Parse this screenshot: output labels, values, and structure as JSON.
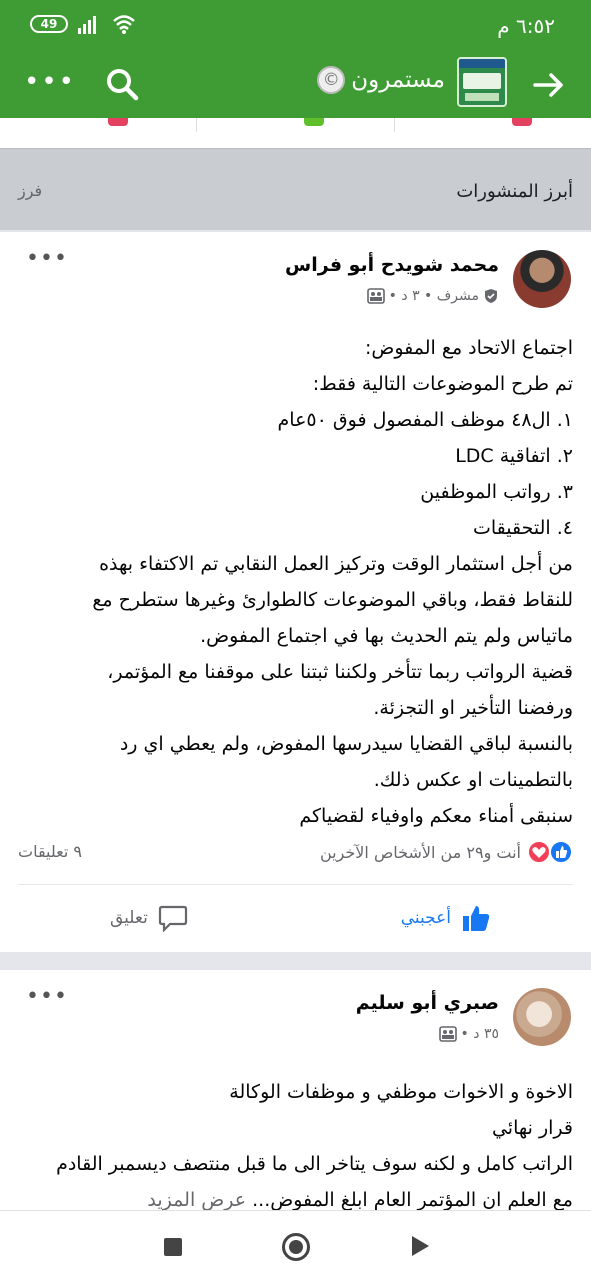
{
  "status_bar": {
    "time": "٦:٥٢ م",
    "battery": "49"
  },
  "app_bar": {
    "group_name": "مستمرون",
    "copyright_glyph": "©"
  },
  "section": {
    "title": "أبرز المنشورات",
    "sort_label": "فرز"
  },
  "post1": {
    "author": "محمد شويدح أبو فراس",
    "meta": "مشرف • ٣ د •",
    "lines": [
      "اجتماع الاتحاد مع المفوض:",
      "تم طرح الموضوعات التالية فقط:",
      "١. ال٤٨ موظف المفصول فوق ٥٠عام",
      "٢. اتفاقية LDC",
      "٣. رواتب الموظفين",
      "٤. التحقيقات",
      "من أجل استثمار الوقت وتركيز العمل النقابي تم الاكتفاء بهذه",
      "للنقاط فقط، وباقي الموضوعات كالطوارئ وغيرها ستطرح مع",
      "ماتياس ولم يتم الحديث بها في اجتماع المفوض.",
      "قضية الرواتب ربما تتأخر ولكننا ثبتنا على موقفنا مع المؤتمر،",
      "ورفضنا التأخير او التجزئة.",
      "بالنسبة لباقي القضايا سيدرسها المفوض، ولم يعطي اي رد",
      "بالتطمينات او عكس ذلك.",
      "سنبقى أمناء معكم واوفياء لقضياكم"
    ],
    "reactions_text": "أنت و٢٩ من الأشخاص الآخرين",
    "comments_count": "٩ تعليقات",
    "like_label": "أعجبني",
    "comment_label": "تعليق"
  },
  "post2": {
    "author": "صبري أبو سليم",
    "meta": "٣٥ د •",
    "lines": [
      "الاخوة و الاخوات موظفي و موظفات الوكالة",
      "قرار نهائي",
      "الراتب كامل و لكنه سوف يتاخر الى ما قبل منتصف ديسمبر القادم"
    ],
    "last_line": "مع العلم ان المؤتمر العام ابلغ المفوض...",
    "see_more": "عرض المزيد"
  },
  "colors": {
    "brand_green": "#3f9c35",
    "like_blue": "#1877f2",
    "love_red": "#f33e58"
  }
}
